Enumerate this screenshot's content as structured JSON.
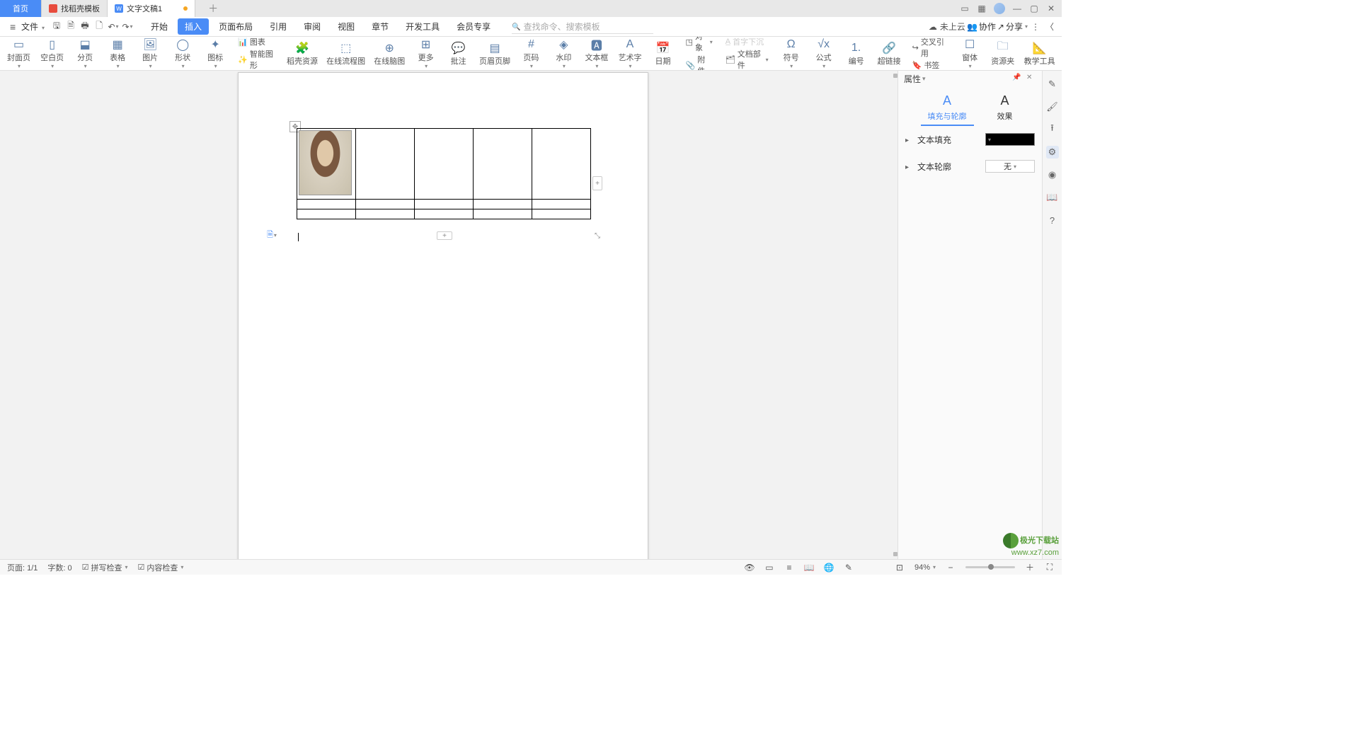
{
  "tabs": {
    "home": "首页",
    "templates": "找稻壳模板",
    "doc": "文字文稿1"
  },
  "file_menu": "文件",
  "menu_tabs": [
    "开始",
    "插入",
    "页面布局",
    "引用",
    "审阅",
    "视图",
    "章节",
    "开发工具",
    "会员专享"
  ],
  "menu_active": "插入",
  "search_placeholder": "查找命令、搜索模板",
  "menubar_right": {
    "cloud": "未上云",
    "collab": "协作",
    "share": "分享"
  },
  "ribbon": {
    "cover": "封面页",
    "blank": "空白页",
    "break": "分页",
    "table": "表格",
    "picture": "图片",
    "shape": "形状",
    "icon": "图标",
    "chart": "图表",
    "smart": "智能图形",
    "docer": "稻壳资源",
    "flowchart": "在线流程图",
    "mindmap": "在线脑图",
    "more": "更多",
    "comment": "批注",
    "headerfooter": "页眉页脚",
    "pagenum": "页码",
    "watermark": "水印",
    "textbox": "文本框",
    "wordart": "艺术字",
    "date": "日期",
    "object": "对象",
    "attachment": "附件",
    "docpart": "文档部件",
    "dropcap": "首字下沉",
    "symbol": "符号",
    "equation": "公式",
    "number": "编号",
    "hyperlink": "超链接",
    "crossref": "交叉引用",
    "bookmark": "书签",
    "widget": "窗体",
    "resource": "资源夹",
    "teach": "教学工具"
  },
  "prop": {
    "title": "属性",
    "tab_fill": "填充与轮廓",
    "tab_effect": "效果",
    "text_fill": "文本填充",
    "text_outline": "文本轮廓",
    "outline_value": "无"
  },
  "status": {
    "page": "页面: 1/1",
    "words": "字数: 0",
    "spell": "拼写检查",
    "content": "内容检查",
    "zoom": "94%"
  },
  "watermark": {
    "line1": "极光下载站",
    "line2": "www.xz7.com"
  }
}
